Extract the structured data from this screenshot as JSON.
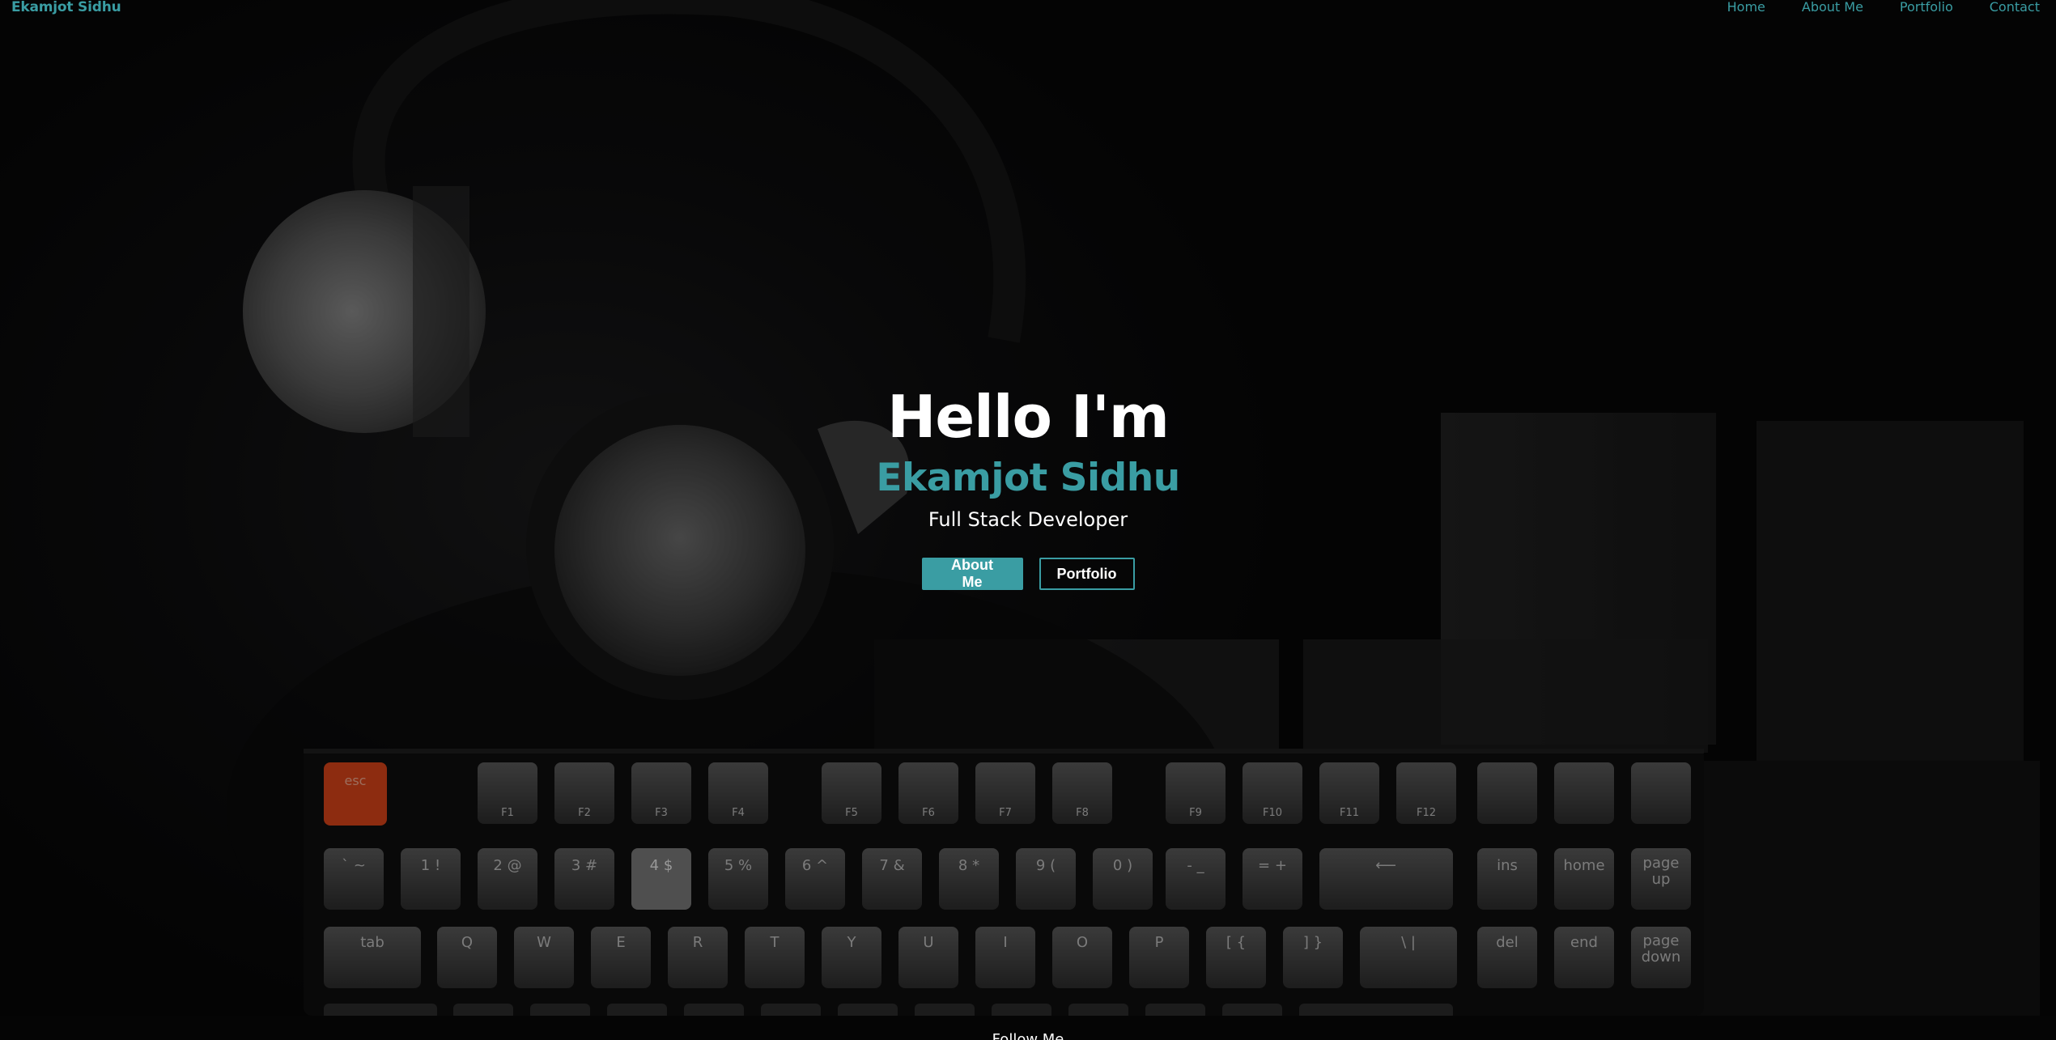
{
  "navbar": {
    "brand": "Ekamjot Sidhu",
    "links": [
      {
        "label": "Home"
      },
      {
        "label": "About Me"
      },
      {
        "label": "Portfolio"
      },
      {
        "label": "Contact"
      }
    ]
  },
  "hero": {
    "greeting": "Hello I'm",
    "name": "Ekamjot Sidhu",
    "role": "Full Stack Developer",
    "buttons": {
      "about_label": "About Me",
      "portfolio_label": "Portfolio"
    },
    "keyboard": {
      "fn_row": [
        "esc",
        "F1",
        "F2",
        "F3",
        "F4",
        "F5",
        "F6",
        "F7",
        "F8",
        "F9",
        "F10",
        "F11",
        "F12"
      ],
      "number_row": [
        "` ~",
        "1 !",
        "2 @",
        "3 #",
        "4 $",
        "5 %",
        "6 ^",
        "7 &",
        "8 *",
        "9 (",
        "0 )",
        "- _",
        "= +"
      ],
      "top_row": [
        "tab",
        "Q",
        "W",
        "E",
        "R",
        "T",
        "Y",
        "U",
        "I",
        "O",
        "P",
        "[ {",
        "] }",
        "\\ |"
      ],
      "nav_keys": [
        "ins",
        "home",
        "page up",
        "del",
        "end",
        "page down"
      ]
    }
  },
  "footer": {
    "follow_text": "Follow Me"
  },
  "colors": {
    "accent": "#3a9da3",
    "background": "#000000",
    "text": "#ffffff",
    "esc_key": "#e0481a"
  }
}
